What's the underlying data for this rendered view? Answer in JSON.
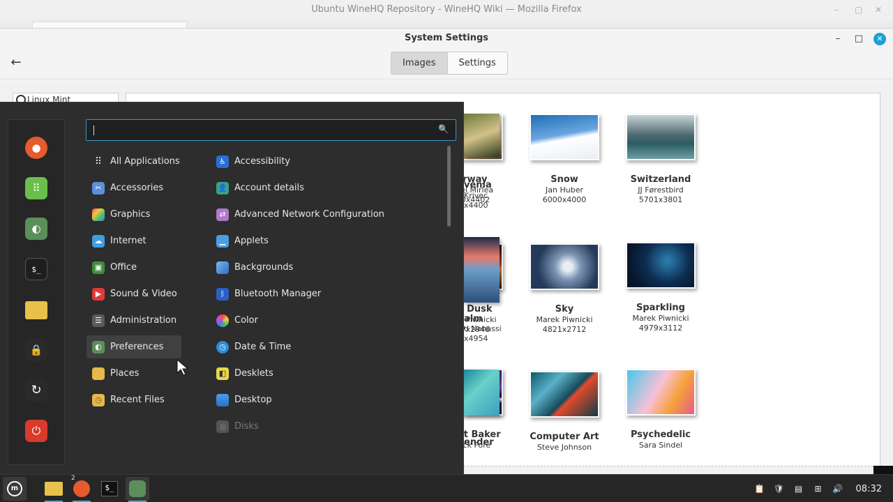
{
  "firefox": {
    "title": "Ubuntu WineHQ Repository - WineHQ Wiki — Mozilla Firefox"
  },
  "settings_window": {
    "title": "System Settings",
    "tabs": [
      {
        "label": "Images",
        "active": true
      },
      {
        "label": "Settings",
        "active": false
      }
    ],
    "source_list_item": "Linux Mint",
    "wallpapers": [
      {
        "name": "venia",
        "author": "Krivec",
        "size": "x4400"
      },
      {
        "name": "Norway",
        "author": "Daniel Mirlea",
        "size": "6600x4402"
      },
      {
        "name": "Snow",
        "author": "Jan Huber",
        "size": "6000x4000"
      },
      {
        "name": "Switzerland",
        "author": "JJ Førestbird",
        "size": "5701x3801"
      },
      {
        "name": "alm",
        "author": "d Nohassi",
        "size": "x4954"
      },
      {
        "name": "Red Dusk",
        "author": "Marek Piwnicki",
        "size": "5237x2946"
      },
      {
        "name": "Sky",
        "author": "Marek Piwnicki",
        "size": "4821x2712"
      },
      {
        "name": "Sparkling",
        "author": "Marek Piwnicki",
        "size": "4979x3112"
      },
      {
        "name": "ender",
        "author": "",
        "size": ""
      },
      {
        "name": "Mount Baker",
        "author": "Patrick Fore",
        "size": ""
      },
      {
        "name": "Computer Art",
        "author": "Steve Johnson",
        "size": ""
      },
      {
        "name": "Psychedelic",
        "author": "Sara Sindel",
        "size": ""
      }
    ]
  },
  "menu": {
    "search": {
      "value": "",
      "placeholder": ""
    },
    "favorites": [
      {
        "name": "firefox-icon",
        "color": "#e55b2d"
      },
      {
        "name": "software-manager-icon",
        "color": "#6abf4b"
      },
      {
        "name": "system-settings-icon",
        "color": "#5a8f5a"
      },
      {
        "name": "terminal-icon",
        "color": "#1e1e1e"
      },
      {
        "name": "files-icon",
        "color": "#e8c14a"
      },
      {
        "name": "lock-icon",
        "color": "#2a2a2a"
      },
      {
        "name": "logout-icon",
        "color": "#2a2a2a"
      },
      {
        "name": "power-icon",
        "color": "#d93a2b"
      }
    ],
    "categories": [
      {
        "label": "All Applications"
      },
      {
        "label": "Accessories"
      },
      {
        "label": "Graphics"
      },
      {
        "label": "Internet"
      },
      {
        "label": "Office"
      },
      {
        "label": "Sound & Video"
      },
      {
        "label": "Administration"
      },
      {
        "label": "Preferences"
      },
      {
        "label": "Places"
      },
      {
        "label": "Recent Files"
      }
    ],
    "apps": [
      {
        "label": "Accessibility"
      },
      {
        "label": "Account details"
      },
      {
        "label": "Advanced Network Configuration"
      },
      {
        "label": "Applets"
      },
      {
        "label": "Backgrounds"
      },
      {
        "label": "Bluetooth Manager"
      },
      {
        "label": "Color"
      },
      {
        "label": "Date & Time"
      },
      {
        "label": "Desklets"
      },
      {
        "label": "Desktop"
      },
      {
        "label": "Disks"
      }
    ]
  },
  "panel": {
    "firefox_badge": "2",
    "clock": "08:32"
  }
}
